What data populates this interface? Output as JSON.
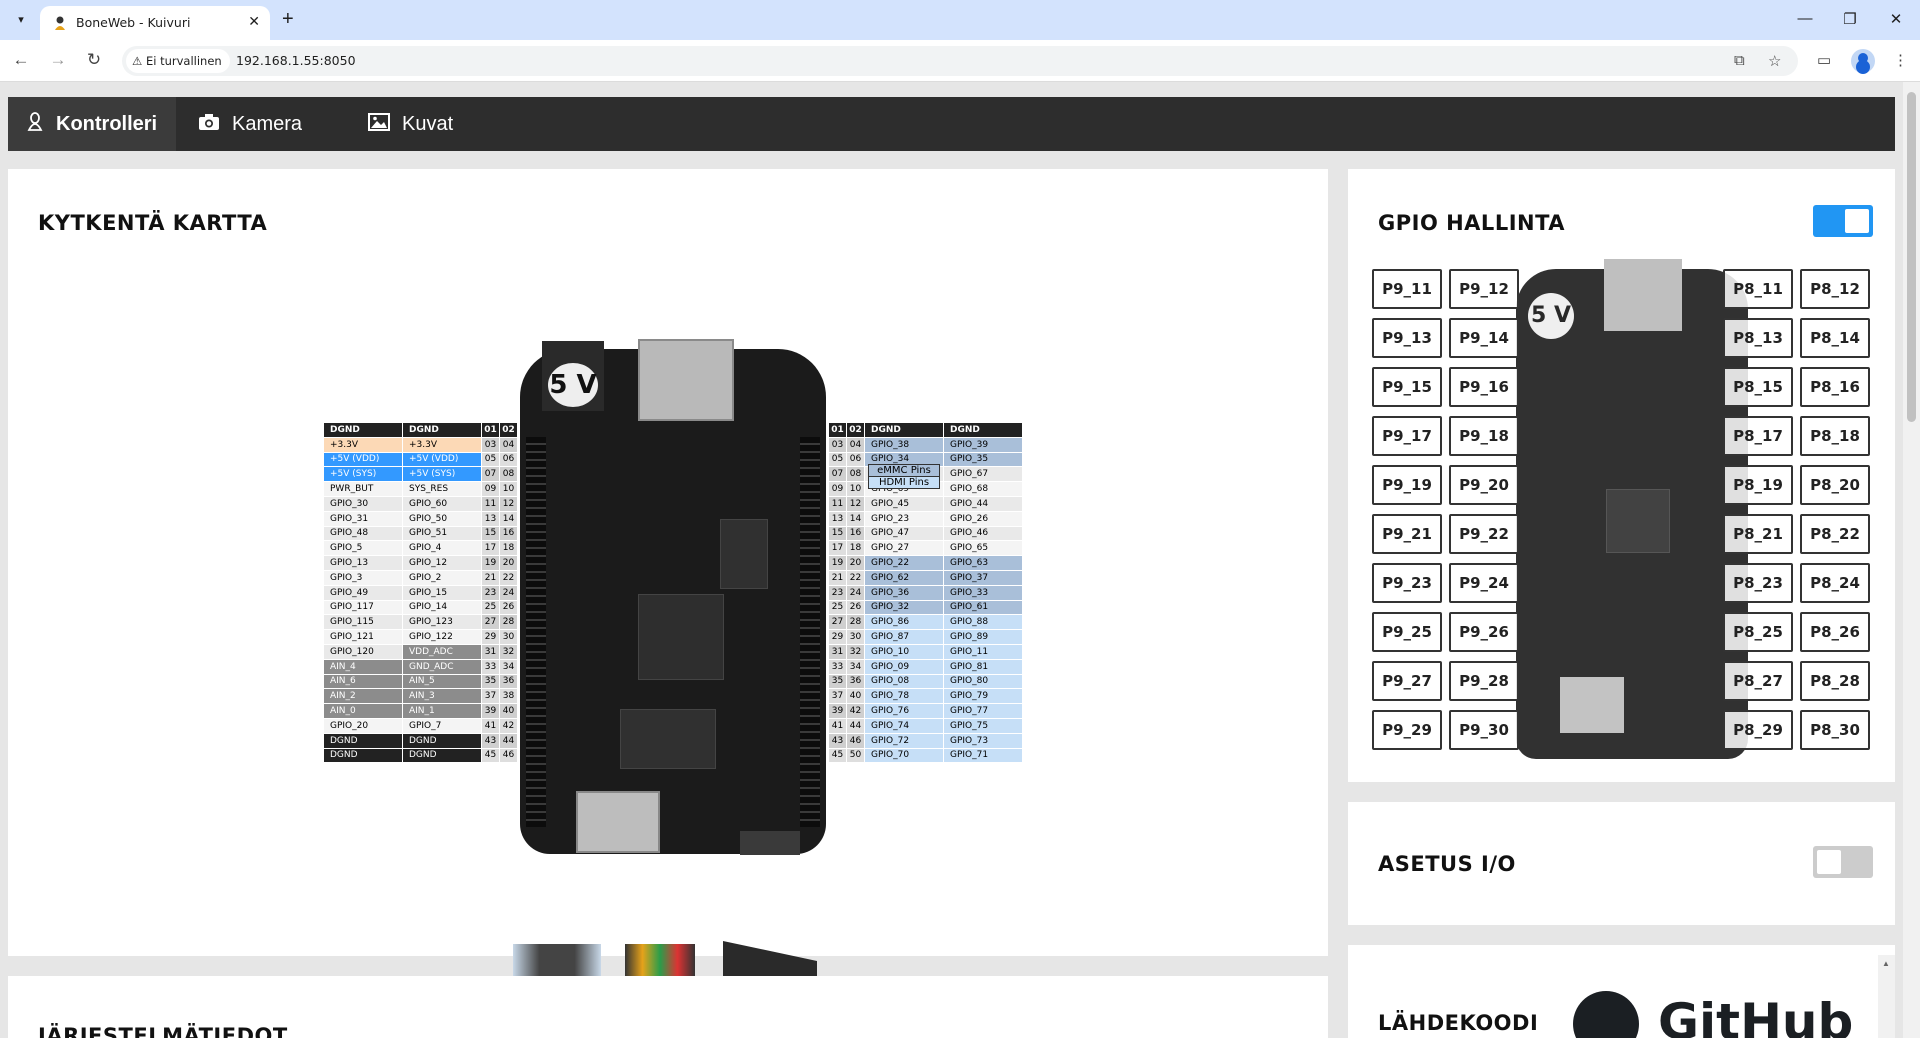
{
  "browser": {
    "tab_title": "BoneWeb - Kuivuri",
    "security_label": "Ei turvallinen",
    "url": "192.168.1.55:8050"
  },
  "nav": {
    "items": [
      {
        "label": "Kontrolleri",
        "icon": "linux-icon"
      },
      {
        "label": "Kamera",
        "icon": "camera-icon"
      },
      {
        "label": "Kuvat",
        "icon": "image-icon"
      }
    ]
  },
  "wiring": {
    "title": "KYTKENTÄ KARTTA",
    "board_text": "5 V",
    "legend": [
      "eMMC Pins",
      "HDMI Pins"
    ],
    "p9": [
      [
        "DGND",
        "DGND",
        "01",
        "02"
      ],
      [
        "+3.3V",
        "+3.3V",
        "03",
        "04"
      ],
      [
        "+5V (VDD)",
        "+5V (VDD)",
        "05",
        "06"
      ],
      [
        "+5V (SYS)",
        "+5V (SYS)",
        "07",
        "08"
      ],
      [
        "PWR_BUT",
        "SYS_RES",
        "09",
        "10"
      ],
      [
        "GPIO_30",
        "GPIO_60",
        "11",
        "12"
      ],
      [
        "GPIO_31",
        "GPIO_50",
        "13",
        "14"
      ],
      [
        "GPIO_48",
        "GPIO_51",
        "15",
        "16"
      ],
      [
        "GPIO_5",
        "GPIO_4",
        "17",
        "18"
      ],
      [
        "GPIO_13",
        "GPIO_12",
        "19",
        "20"
      ],
      [
        "GPIO_3",
        "GPIO_2",
        "21",
        "22"
      ],
      [
        "GPIO_49",
        "GPIO_15",
        "23",
        "24"
      ],
      [
        "GPIO_117",
        "GPIO_14",
        "25",
        "26"
      ],
      [
        "GPIO_115",
        "GPIO_123",
        "27",
        "28"
      ],
      [
        "GPIO_121",
        "GPIO_122",
        "29",
        "30"
      ],
      [
        "GPIO_120",
        "VDD_ADC",
        "31",
        "32"
      ],
      [
        "AIN_4",
        "GND_ADC",
        "33",
        "34"
      ],
      [
        "AIN_6",
        "AIN_5",
        "35",
        "36"
      ],
      [
        "AIN_2",
        "AIN_3",
        "37",
        "38"
      ],
      [
        "AIN_0",
        "AIN_1",
        "39",
        "40"
      ],
      [
        "GPIO_20",
        "GPIO_7",
        "41",
        "42"
      ],
      [
        "DGND",
        "DGND",
        "43",
        "44"
      ],
      [
        "DGND",
        "DGND",
        "45",
        "46"
      ]
    ],
    "p8": [
      [
        "01",
        "02",
        "DGND",
        "DGND"
      ],
      [
        "03",
        "04",
        "GPIO_38",
        "GPIO_39"
      ],
      [
        "05",
        "06",
        "GPIO_34",
        "GPIO_35"
      ],
      [
        "07",
        "08",
        "GPIO_66",
        "GPIO_67"
      ],
      [
        "09",
        "10",
        "GPIO_69",
        "GPIO_68"
      ],
      [
        "11",
        "12",
        "GPIO_45",
        "GPIO_44"
      ],
      [
        "13",
        "14",
        "GPIO_23",
        "GPIO_26"
      ],
      [
        "15",
        "16",
        "GPIO_47",
        "GPIO_46"
      ],
      [
        "17",
        "18",
        "GPIO_27",
        "GPIO_65"
      ],
      [
        "19",
        "20",
        "GPIO_22",
        "GPIO_63"
      ],
      [
        "21",
        "22",
        "GPIO_62",
        "GPIO_37"
      ],
      [
        "23",
        "24",
        "GPIO_36",
        "GPIO_33"
      ],
      [
        "25",
        "26",
        "GPIO_32",
        "GPIO_61"
      ],
      [
        "27",
        "28",
        "GPIO_86",
        "GPIO_88"
      ],
      [
        "29",
        "30",
        "GPIO_87",
        "GPIO_89"
      ],
      [
        "31",
        "32",
        "GPIO_10",
        "GPIO_11"
      ],
      [
        "33",
        "34",
        "GPIO_09",
        "GPIO_81"
      ],
      [
        "35",
        "36",
        "GPIO_08",
        "GPIO_80"
      ],
      [
        "37",
        "40",
        "GPIO_78",
        "GPIO_79"
      ],
      [
        "39",
        "42",
        "GPIO_76",
        "GPIO_77"
      ],
      [
        "41",
        "44",
        "GPIO_74",
        "GPIO_75"
      ],
      [
        "43",
        "46",
        "GPIO_72",
        "GPIO_73"
      ],
      [
        "45",
        "50",
        "GPIO_70",
        "GPIO_71"
      ]
    ]
  },
  "gpio": {
    "title": "GPIO HALLINTA",
    "toggle_on": true,
    "left_pins": [
      "P9_11",
      "P9_12",
      "P9_13",
      "P9_14",
      "P9_15",
      "P9_16",
      "P9_17",
      "P9_18",
      "P9_19",
      "P9_20",
      "P9_21",
      "P9_22",
      "P9_23",
      "P9_24",
      "P9_25",
      "P9_26",
      "P9_27",
      "P9_28",
      "P9_29",
      "P9_30"
    ],
    "right_pins": [
      "P8_11",
      "P8_12",
      "P8_13",
      "P8_14",
      "P8_15",
      "P8_16",
      "P8_17",
      "P8_18",
      "P8_19",
      "P8_20",
      "P8_21",
      "P8_22",
      "P8_23",
      "P8_24",
      "P8_25",
      "P8_26",
      "P8_27",
      "P8_28",
      "P8_29",
      "P8_30"
    ]
  },
  "asetus": {
    "title": "ASETUS I/O",
    "toggle_on": false
  },
  "source": {
    "title": "LÄHDEKOODI",
    "logo_text": "GitHub"
  },
  "system": {
    "title": "JÄRJESTELMÄTIEDOT"
  },
  "colors": {
    "navbar": "#2d2d2d",
    "toggle_on": "#2196f3",
    "toggle_off": "#cccccc",
    "pin_power33": "#fcd9b6",
    "pin_power5": "#3399ff",
    "pin_dark": "#222222",
    "pin_analog": "#8c8c8c",
    "pin_emmc": "#a9bfd9",
    "pin_hdmi": "#c6dff7"
  }
}
